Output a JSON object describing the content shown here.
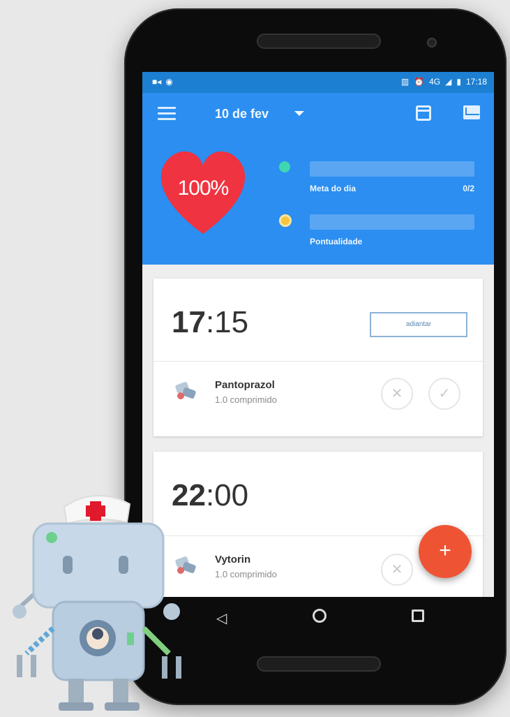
{
  "status_bar": {
    "left_icons": [
      "video-icon",
      "wifi-icon"
    ],
    "right_icons": [
      "vibrate-icon",
      "alarm-icon",
      "network-4g-icon",
      "signal-icon",
      "battery-icon"
    ],
    "network_label": "4G",
    "time": "17:18"
  },
  "app_bar": {
    "menu_icon": "menu-icon",
    "date": "10 de fev",
    "dropdown_icon": "caret-down-icon",
    "calendar_icon": "calendar-icon",
    "mail_icon": "mail-icon"
  },
  "summary": {
    "heart_percent": "100%",
    "heart_color": "#ef3340",
    "goal": {
      "label": "Meta do dia",
      "count": "0/2",
      "progress": 0
    },
    "punctuality": {
      "label": "Pontualidade",
      "progress": 0
    }
  },
  "schedule": [
    {
      "time_hour": "17",
      "time_minutes": ":15",
      "postpone_label": "adiantar",
      "medicine": {
        "name": "Pantoprazol",
        "dose": "1.0 comprimido"
      }
    },
    {
      "time_hour": "22",
      "time_minutes": ":00",
      "medicine": {
        "name": "Vytorin",
        "dose": "1.0 comprimido"
      }
    }
  ],
  "actions": {
    "skip_glyph": "✕",
    "take_glyph": "✓",
    "fab_glyph": "+"
  },
  "navigation": {
    "back_glyph": "◁"
  },
  "colors": {
    "primary": "#2b8ef0",
    "status_bar": "#1c7fd2",
    "fab": "#ee5434"
  }
}
